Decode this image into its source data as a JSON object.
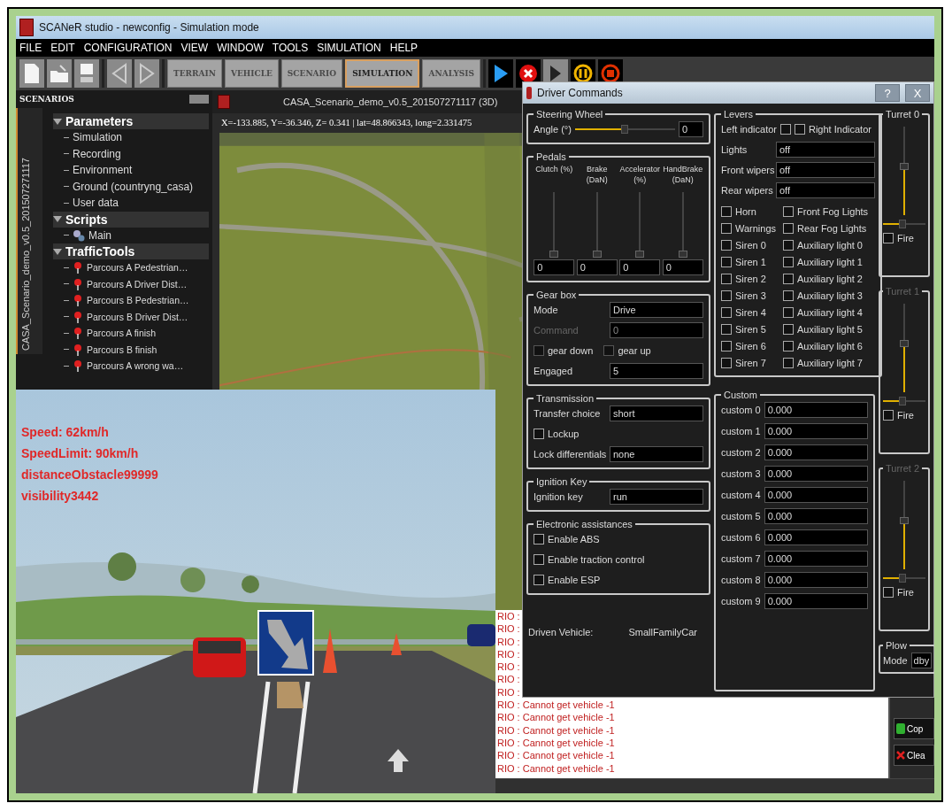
{
  "window": {
    "title": "SCANeR studio - newconfig - Simulation mode"
  },
  "menu": [
    "FILE",
    "EDIT",
    "CONFIGURATION",
    "VIEW",
    "WINDOW",
    "TOOLS",
    "SIMULATION",
    "HELP"
  ],
  "modes": [
    {
      "label": "TERRAIN",
      "selected": false
    },
    {
      "label": "VEHICLE",
      "selected": false
    },
    {
      "label": "SCENARIO",
      "selected": false
    },
    {
      "label": "SIMULATION",
      "selected": true
    },
    {
      "label": "ANALYSIS",
      "selected": false
    }
  ],
  "scenarios_panel": {
    "title": "SCENARIOS",
    "scenario_name": "CASA_Scenario_demo_v0.5_201507271117",
    "tree": [
      {
        "label": "Parameters",
        "expanded": true,
        "children": [
          {
            "label": "Simulation",
            "kind": "setting"
          },
          {
            "label": "Recording",
            "kind": "setting"
          },
          {
            "label": "Environment",
            "kind": "setting"
          },
          {
            "label": "Ground (countryng_casa)",
            "kind": "setting"
          },
          {
            "label": "User data",
            "kind": "setting"
          }
        ]
      },
      {
        "label": "Scripts",
        "expanded": true,
        "children": [
          {
            "label": "Main",
            "kind": "script"
          }
        ]
      },
      {
        "label": "TrafficTools",
        "expanded": true,
        "children": [
          {
            "label": "Parcours A Pedestrian…",
            "kind": "tool"
          },
          {
            "label": "Parcours A Driver Dist…",
            "kind": "tool"
          },
          {
            "label": "Parcours B Pedestrian…",
            "kind": "tool"
          },
          {
            "label": "Parcours B Driver Dist…",
            "kind": "tool"
          },
          {
            "label": "Parcours A finish",
            "kind": "tool"
          },
          {
            "label": "Parcours B finish",
            "kind": "tool"
          },
          {
            "label": "Parcours A wrong wa…",
            "kind": "tool"
          }
        ]
      }
    ]
  },
  "map_view": {
    "title": "CASA_Scenario_demo_v0.5_201507271117 (3D)",
    "coordinates": "X=-133.885, Y=-36.346, Z= 0.341 | lat=48.866343, long=2.331475"
  },
  "log": {
    "lines": [
      "RIO :",
      "RIO :",
      "RIO :",
      "RIO :",
      "RIO :",
      "RIO :",
      "RIO :",
      "RIO : Cannot get vehicle -1",
      "RIO : Cannot get vehicle -1",
      "RIO : Cannot get vehicle -1",
      "RIO : Cannot get vehicle -1",
      "RIO : Cannot get vehicle -1",
      "RIO : Cannot get vehicle -1"
    ],
    "buttons": [
      {
        "label": "Cop",
        "kind": "copy"
      },
      {
        "label": "Clea",
        "kind": "clear"
      }
    ]
  },
  "view_3d": {
    "hud": [
      "Speed: 62km/h",
      "SpeedLimit: 90km/h",
      "distanceObstacle99999",
      "visibility3442"
    ]
  },
  "driver_commands": {
    "title": "Driver Commands",
    "help": "?",
    "close": "X",
    "steering_wheel": {
      "title": "Steering Wheel",
      "label": "Angle (°)",
      "level": 0.5,
      "value": "0"
    },
    "pedals": {
      "title": "Pedals",
      "items": [
        {
          "label": "Clutch (%)",
          "level": 0,
          "value": "0"
        },
        {
          "label": "Brake (DaN)",
          "level": 0,
          "value": "0"
        },
        {
          "label": "Accelerator (%)",
          "level": 0,
          "value": "0"
        },
        {
          "label": "HandBrake (DaN)",
          "level": 0,
          "value": "0"
        }
      ]
    },
    "groups": [
      {
        "title": "Gear box",
        "rows": [
          {
            "kind": "field",
            "label": "Mode",
            "value": "Drive",
            "disabled": false
          },
          {
            "kind": "field",
            "label": "Command",
            "value": "0",
            "disabled": true
          },
          {
            "kind": "checks",
            "items": [
              {
                "label": "gear down",
                "checked": false,
                "disabled": true
              },
              {
                "label": "gear up",
                "checked": false,
                "disabled": true
              }
            ]
          },
          {
            "kind": "field",
            "label": "Engaged",
            "value": "5",
            "disabled": false
          }
        ]
      },
      {
        "title": "Transmission",
        "rows": [
          {
            "kind": "field",
            "label": "Transfer choice",
            "value": "short",
            "disabled": false
          },
          {
            "kind": "checks",
            "items": [
              {
                "label": "Lockup",
                "checked": false,
                "disabled": false
              }
            ]
          },
          {
            "kind": "field",
            "label": "Lock differentials",
            "value": "none",
            "disabled": false
          }
        ]
      },
      {
        "title": "Ignition Key",
        "rows": [
          {
            "kind": "field",
            "label": "Ignition key",
            "value": "run",
            "disabled": false
          }
        ]
      },
      {
        "title": "Electronic assistances",
        "rows": [
          {
            "kind": "checks",
            "items": [
              {
                "label": "Enable ABS",
                "checked": false,
                "disabled": false
              }
            ]
          },
          {
            "kind": "checks",
            "items": [
              {
                "label": "Enable traction control",
                "checked": false,
                "disabled": false
              }
            ]
          },
          {
            "kind": "checks",
            "items": [
              {
                "label": "Enable ESP",
                "checked": false,
                "disabled": false
              }
            ]
          }
        ]
      }
    ],
    "driven_vehicle": {
      "label": "Driven Vehicle:",
      "value": "SmallFamilyCar"
    },
    "levers": {
      "title": "Levers",
      "indicators": [
        {
          "label": "Left indicator",
          "checked": false
        },
        {
          "label": "Right Indicator",
          "checked": false
        }
      ],
      "fields": [
        {
          "label": "Lights",
          "value": "off"
        },
        {
          "label": "Front wipers",
          "value": "off"
        },
        {
          "label": "Rear wipers",
          "value": "off"
        }
      ],
      "toggles": [
        {
          "label": "Horn",
          "checked": false
        },
        {
          "label": "Front Fog Lights",
          "checked": false
        },
        {
          "label": "Warnings",
          "checked": false
        },
        {
          "label": "Rear Fog Lights",
          "checked": false
        },
        {
          "label": "Siren 0",
          "checked": false
        },
        {
          "label": "Auxiliary light 0",
          "checked": false
        },
        {
          "label": "Siren 1",
          "checked": false
        },
        {
          "label": "Auxiliary light 1",
          "checked": false
        },
        {
          "label": "Siren 2",
          "checked": false
        },
        {
          "label": "Auxiliary light 2",
          "checked": false
        },
        {
          "label": "Siren 3",
          "checked": false
        },
        {
          "label": "Auxiliary light 3",
          "checked": false
        },
        {
          "label": "Siren 4",
          "checked": false
        },
        {
          "label": "Auxiliary light 4",
          "checked": false
        },
        {
          "label": "Siren 5",
          "checked": false
        },
        {
          "label": "Auxiliary light 5",
          "checked": false
        },
        {
          "label": "Siren 6",
          "checked": false
        },
        {
          "label": "Auxiliary light 6",
          "checked": false
        },
        {
          "label": "Siren 7",
          "checked": false
        },
        {
          "label": "Auxiliary light 7",
          "checked": false
        }
      ]
    },
    "custom": {
      "title": "Custom",
      "fields": [
        {
          "label": "custom 0",
          "value": "0.000"
        },
        {
          "label": "custom 1",
          "value": "0.000"
        },
        {
          "label": "custom 2",
          "value": "0.000"
        },
        {
          "label": "custom 3",
          "value": "0.000"
        },
        {
          "label": "custom 4",
          "value": "0.000"
        },
        {
          "label": "custom 5",
          "value": "0.000"
        },
        {
          "label": "custom 6",
          "value": "0.000"
        },
        {
          "label": "custom 7",
          "value": "0.000"
        },
        {
          "label": "custom 8",
          "value": "0.000"
        },
        {
          "label": "custom 9",
          "value": "0.000"
        }
      ]
    },
    "turrets": [
      {
        "title": "Turret 0",
        "disabled": false,
        "sliders": [
          {
            "kind": "vertical",
            "level": 0.55
          },
          {
            "kind": "horizontal",
            "level": 0.45
          }
        ],
        "fire": {
          "label": "Fire",
          "checked": false
        }
      },
      {
        "title": "Turret 1",
        "disabled": true,
        "sliders": [
          {
            "kind": "vertical",
            "level": 0.55
          },
          {
            "kind": "horizontal",
            "level": 0.45
          }
        ],
        "fire": {
          "label": "Fire",
          "checked": false
        }
      },
      {
        "title": "Turret 2",
        "disabled": true,
        "sliders": [
          {
            "kind": "vertical",
            "level": 0.55
          },
          {
            "kind": "horizontal",
            "level": 0.45
          }
        ],
        "fire": {
          "label": "Fire",
          "checked": false
        }
      }
    ],
    "plow": {
      "title": "Plow",
      "label": "Mode",
      "value": "dby"
    }
  }
}
